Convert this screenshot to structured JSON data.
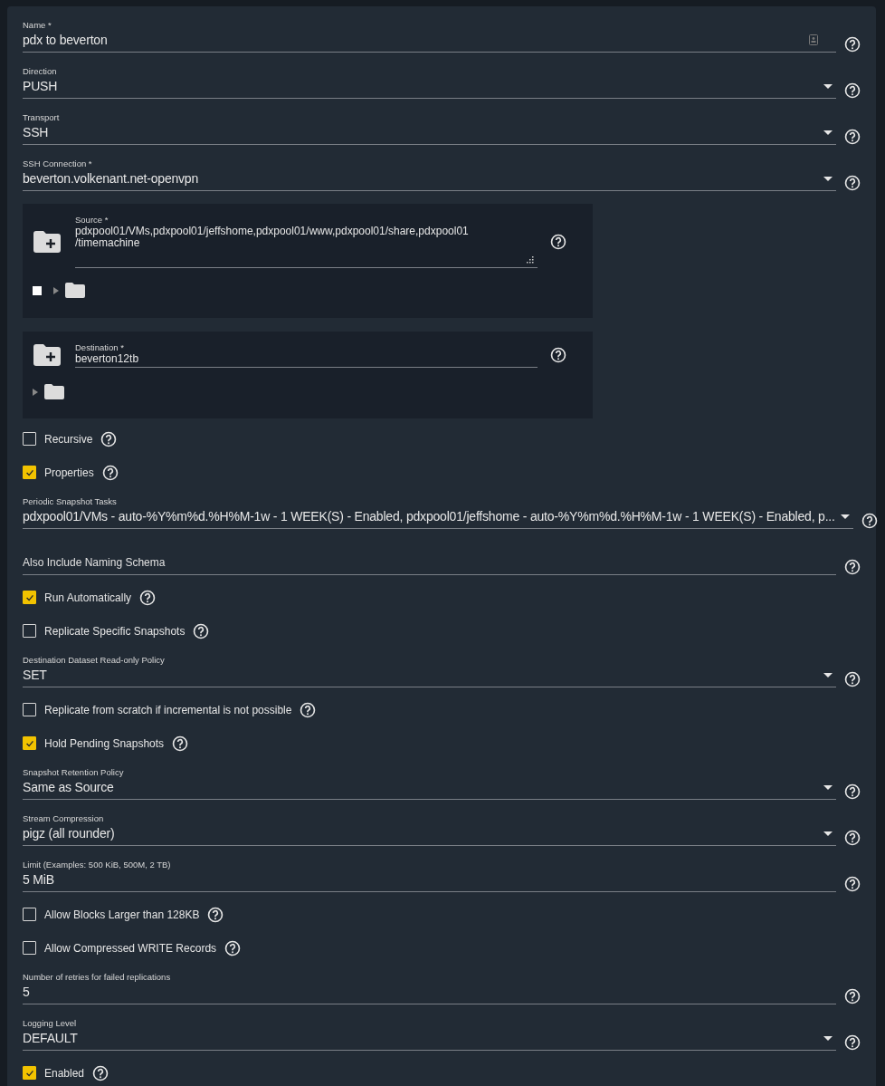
{
  "fields": [
    {
      "kind": "text",
      "label": "Name *",
      "value": "pdx to beverton",
      "autofill_icon": true
    },
    {
      "kind": "select",
      "label": "Direction",
      "value": "PUSH"
    },
    {
      "kind": "select",
      "label": "Transport",
      "value": "SSH"
    },
    {
      "kind": "select",
      "label": "SSH Connection *",
      "value": "beverton.volkenant.net-openvpn"
    },
    {
      "kind": "explorer",
      "label": "Source *",
      "value": "pdxpool01/VMs,pdxpool01/jeffshome,pdxpool01/www,pdxpool01/share,pdxpool01\n/timemachine",
      "multiline": true,
      "tree_checked": false
    },
    {
      "kind": "explorer",
      "label": "Destination *",
      "value": "beverton12tb",
      "multiline": false
    },
    {
      "kind": "checkbox",
      "label": "Recursive",
      "checked": false
    },
    {
      "kind": "checkbox",
      "label": "Properties",
      "checked": true
    },
    {
      "kind": "select",
      "label": "Periodic Snapshot Tasks",
      "value": "pdxpool01/VMs - auto-%Y%m%d.%H%M-1w - 1 WEEK(S) - Enabled, pdxpool01/jeffshome - auto-%Y%m%d.%H%M-1w - 1 WEEK(S) - Enabled, p..."
    },
    {
      "kind": "text",
      "placeholder": "Also Include Naming Schema"
    },
    {
      "kind": "checkbox",
      "label": "Run Automatically",
      "checked": true
    },
    {
      "kind": "checkbox",
      "label": "Replicate Specific Snapshots",
      "checked": false
    },
    {
      "kind": "select",
      "label": "Destination Dataset Read-only Policy",
      "value": "SET"
    },
    {
      "kind": "checkbox",
      "label": "Replicate from scratch if incremental is not possible",
      "checked": false
    },
    {
      "kind": "checkbox",
      "label": "Hold Pending Snapshots",
      "checked": true
    },
    {
      "kind": "select",
      "label": "Snapshot Retention Policy",
      "value": "Same as Source"
    },
    {
      "kind": "select",
      "label": "Stream Compression",
      "value": "pigz (all rounder)"
    },
    {
      "kind": "text",
      "label": "Limit (Examples: 500 KiB, 500M, 2 TB)",
      "value": "5 MiB"
    },
    {
      "kind": "checkbox",
      "label": "Allow Blocks Larger than 128KB",
      "checked": false
    },
    {
      "kind": "checkbox",
      "label": "Allow Compressed WRITE Records",
      "checked": false
    },
    {
      "kind": "text",
      "label": "Number of retries for failed replications",
      "value": "5"
    },
    {
      "kind": "select",
      "label": "Logging Level",
      "value": "DEFAULT"
    },
    {
      "kind": "checkbox",
      "label": "Enabled",
      "checked": true
    }
  ]
}
